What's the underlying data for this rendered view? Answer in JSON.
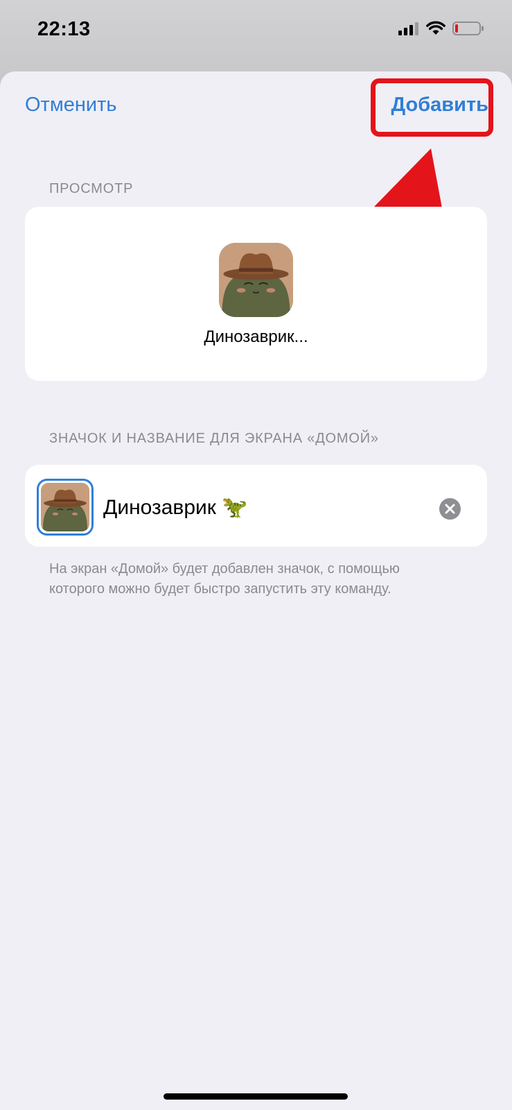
{
  "status_bar": {
    "time": "22:13",
    "icons": [
      "signal-icon",
      "wifi-icon",
      "battery-icon"
    ]
  },
  "nav": {
    "cancel_label": "Отменить",
    "add_label": "Добавить"
  },
  "preview": {
    "section_title": "ПРОСМОТР",
    "icon_name": "cowboy-frog-icon",
    "app_label": "Динозаврик..."
  },
  "home_screen": {
    "section_title": "ЗНАЧОК И НАЗВАНИЕ ДЛЯ ЭКРАНА «ДОМОЙ»",
    "name_value": "Динозаврик 🦖",
    "footnote": "На экран «Домой» будет добавлен значок, с помощью которого можно будет быстро запустить эту команду."
  },
  "colors": {
    "accent": "#2f7fd6",
    "annotation": "#e4141b",
    "sheet_bg": "#f0eff5",
    "card_bg": "#ffffff",
    "secondary_text": "#8a8a8f"
  }
}
